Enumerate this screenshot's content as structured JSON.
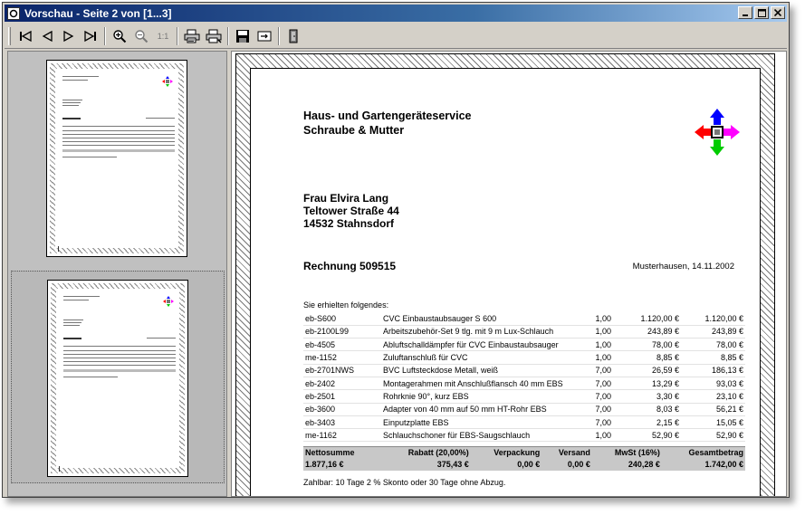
{
  "window": {
    "title": "Vorschau - Seite 2 von [1...3]",
    "controls": {
      "minimize": "_",
      "maximize": "□",
      "close": "×"
    }
  },
  "toolbar": {
    "buttons": [
      {
        "name": "first-page",
        "icon": "first-page-icon"
      },
      {
        "name": "previous-page",
        "icon": "previous-page-icon"
      },
      {
        "name": "next-page",
        "icon": "next-page-icon"
      },
      {
        "name": "last-page",
        "icon": "last-page-icon"
      },
      {
        "name": "zoom-in",
        "icon": "zoom-in-icon"
      },
      {
        "name": "zoom-out",
        "icon": "zoom-out-icon"
      },
      {
        "name": "actual-size",
        "icon": "actual-size-icon",
        "label": "1:1"
      },
      {
        "name": "print",
        "icon": "printer-icon"
      },
      {
        "name": "print-setup",
        "icon": "printer-setup-icon"
      },
      {
        "name": "save",
        "icon": "floppy-disk-icon"
      },
      {
        "name": "export",
        "icon": "export-icon"
      },
      {
        "name": "close",
        "icon": "exit-door-icon"
      }
    ]
  },
  "invoice": {
    "company_line1": "Haus- und Gartengeräteservice",
    "company_line2": "Schraube & Mutter",
    "recipient_name": "Frau Elvira Lang",
    "recipient_street": "Teltower Straße 44",
    "recipient_city": "14532 Stahnsdorf",
    "title": "Rechnung 509515",
    "place_date": "Musterhausen, 14.11.2002",
    "intro": "Sie erhielten folgendes:",
    "items": [
      {
        "sku": "eb-S600",
        "desc": "CVC Einbaustaubsauger S 600",
        "qty": "1,00",
        "price": "1.120,00 €",
        "total": "1.120,00 €"
      },
      {
        "sku": "eb-2100L99",
        "desc": "Arbeitszubehör-Set 9 tlg. mit 9 m Lux-Schlauch",
        "qty": "1,00",
        "price": "243,89 €",
        "total": "243,89 €"
      },
      {
        "sku": "eb-4505",
        "desc": "Abluftschalldämpfer für CVC Einbaustaubsauger",
        "qty": "1,00",
        "price": "78,00 €",
        "total": "78,00 €"
      },
      {
        "sku": "me-1152",
        "desc": "Zuluftanschluß für CVC",
        "qty": "1,00",
        "price": "8,85 €",
        "total": "8,85 €"
      },
      {
        "sku": "eb-2701NWS",
        "desc": "BVC Luftsteckdose Metall, weiß",
        "qty": "7,00",
        "price": "26,59 €",
        "total": "186,13 €"
      },
      {
        "sku": "eb-2402",
        "desc": "Montagerahmen mit Anschlußflansch 40 mm EBS",
        "qty": "7,00",
        "price": "13,29 €",
        "total": "93,03 €"
      },
      {
        "sku": "eb-2501",
        "desc": "Rohrknie 90°, kurz EBS",
        "qty": "7,00",
        "price": "3,30 €",
        "total": "23,10 €"
      },
      {
        "sku": "eb-3600",
        "desc": "Adapter von 40 mm auf 50 mm HT-Rohr EBS",
        "qty": "7,00",
        "price": "8,03 €",
        "total": "56,21 €"
      },
      {
        "sku": "eb-3403",
        "desc": "Einputzplatte EBS",
        "qty": "7,00",
        "price": "2,15 €",
        "total": "15,05 €"
      },
      {
        "sku": "me-1162",
        "desc": "Schlauchschoner für EBS-Saugschlauch",
        "qty": "1,00",
        "price": "52,90 €",
        "total": "52,90 €"
      }
    ],
    "sum_headers": {
      "net": "Nettosumme",
      "discount": "Rabatt (20,00%)",
      "packaging": "Verpackung",
      "shipping": "Versand",
      "vat": "MwSt (16%)",
      "gross": "Gesamtbetrag"
    },
    "sum_values": {
      "net": "1.877,16 €",
      "discount": "375,43 €",
      "packaging": "0,00 €",
      "shipping": "0,00 €",
      "vat": "240,28 €",
      "gross": "1.742,00 €"
    },
    "payment_terms": "Zahlbar: 10 Tage 2 % Skonto oder 30 Tage ohne Abzug."
  },
  "colors": {
    "titlebar_start": "#0a246a",
    "titlebar_end": "#a6caf0",
    "arrow_blue": "#0000ff",
    "arrow_red": "#ff0000",
    "arrow_magenta": "#ff00ff",
    "arrow_green": "#00cc00"
  }
}
